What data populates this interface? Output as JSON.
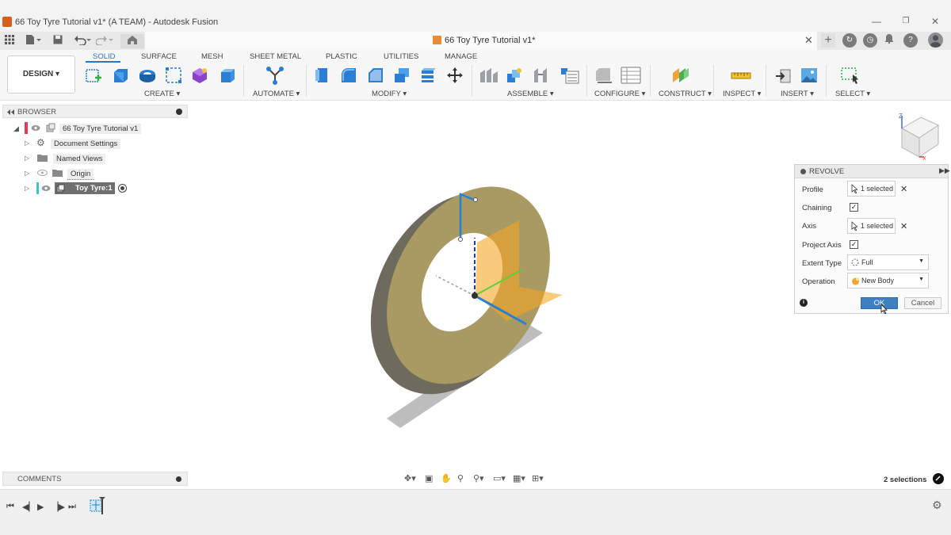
{
  "window": {
    "title": "66 Toy Tyre Tutorial v1* (A TEAM) - Autodesk Fusion",
    "minimize": "—",
    "restore": "❐",
    "close": "✕"
  },
  "document_tab": {
    "label": "66 Toy Tyre Tutorial v1*",
    "close": "✕"
  },
  "toolbar": {
    "design_label": "DESIGN ▾",
    "workspace_tabs": [
      "SOLID",
      "SURFACE",
      "MESH",
      "SHEET METAL",
      "PLASTIC",
      "UTILITIES",
      "MANAGE"
    ],
    "groups": [
      "CREATE ▾",
      "AUTOMATE ▾",
      "MODIFY ▾",
      "ASSEMBLE ▾",
      "CONFIGURE ▾",
      "CONSTRUCT ▾",
      "INSPECT ▾",
      "INSERT ▾",
      "SELECT ▾"
    ]
  },
  "browser": {
    "header": "BROWSER",
    "items": [
      {
        "label": "66 Toy Tyre Tutorial v1"
      },
      {
        "label": "Document Settings"
      },
      {
        "label": "Named Views"
      },
      {
        "label": "Origin"
      },
      {
        "label": "Toy Tyre:1"
      }
    ]
  },
  "comments": {
    "header": "COMMENTS"
  },
  "revolve": {
    "title": "REVOLVE",
    "rows": {
      "profile_label": "Profile",
      "profile_value": "1 selected",
      "chaining_label": "Chaining",
      "axis_label": "Axis",
      "axis_value": "1 selected",
      "project_axis_label": "Project Axis",
      "extent_type_label": "Extent Type",
      "extent_type_value": "Full",
      "operation_label": "Operation",
      "operation_value": "New Body"
    },
    "ok_label": "OK",
    "cancel_label": "Cancel",
    "info": "i"
  },
  "status": {
    "selections": "2 selections"
  },
  "viewcube": {
    "x_label": "X",
    "z_label": "Z"
  },
  "colors": {
    "accent": "#1f78d1",
    "ok_button": "#3e7fc1",
    "body": "#a89a62",
    "sketch_plane": "#f5a623"
  }
}
